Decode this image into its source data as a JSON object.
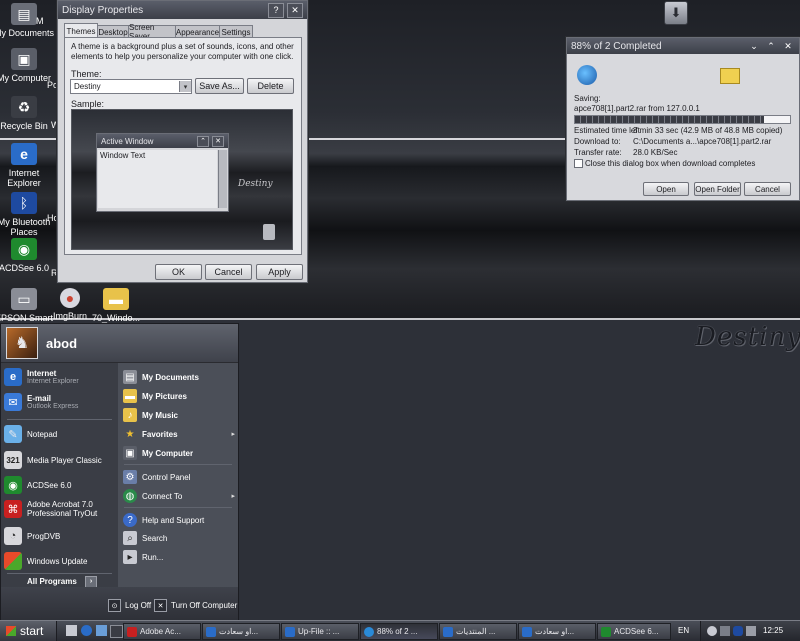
{
  "desktop": {
    "brand": "Destiny",
    "icons": [
      {
        "label": "My Documents"
      },
      {
        "label": "My Computer"
      },
      {
        "label": "Recycle Bin"
      },
      {
        "label": "Internet Explorer"
      },
      {
        "label": "My Bluetooth Places"
      },
      {
        "label": "ACDSee 6.0"
      },
      {
        "label": "EPSON Smart Panel"
      },
      {
        "label": "ImgBurn"
      },
      {
        "label": "70_Windo..."
      }
    ],
    "partial_labels": {
      "my_docs_m": "M",
      "po": "Po",
      "w": "W",
      "ho": "Ho",
      "r": "R"
    }
  },
  "display_props": {
    "title": "Display Properties",
    "tabs": [
      "Themes",
      "Desktop",
      "Screen Saver",
      "Appearance",
      "Settings"
    ],
    "description": "A theme is a background plus a set of sounds, icons, and other elements to help you personalize your computer with one click.",
    "theme_label": "Theme:",
    "theme_value": "Destiny",
    "save_as": "Save As...",
    "delete": "Delete",
    "sample_label": "Sample:",
    "active_window": "Active Window",
    "window_text": "Window Text",
    "preview_brand": "Destiny",
    "ok": "OK",
    "cancel": "Cancel",
    "apply": "Apply"
  },
  "download": {
    "title": "88% of 2 Completed",
    "saving_label": "Saving:",
    "saving_value": "apce708[1].part2.rar from 127.0.0.1",
    "progress": 0.88,
    "time_left_label": "Estimated time left",
    "time_left_value": "3 min 33 sec (42.9 MB of 48.8 MB copied)",
    "download_to_label": "Download to:",
    "download_to_value": "C:\\Documents a...\\apce708[1].part2.rar",
    "rate_label": "Transfer rate:",
    "rate_value": "28.0 KB/Sec",
    "close_checkbox": "Close this dialog box when download completes",
    "open": "Open",
    "open_folder": "Open Folder",
    "cancel": "Cancel"
  },
  "start_menu": {
    "user": "abod",
    "pinned": [
      {
        "name": "Internet",
        "sub": "Internet Explorer"
      },
      {
        "name": "E-mail",
        "sub": "Outlook Express"
      }
    ],
    "recent": [
      {
        "name": "Notepad"
      },
      {
        "name": "Media Player Classic"
      },
      {
        "name": "ACDSee 6.0"
      },
      {
        "name": "Adobe Acrobat 7.0",
        "sub": "Professional TryOut"
      },
      {
        "name": "ProgDVB"
      },
      {
        "name": "Windows Update"
      }
    ],
    "all_programs": "All Programs",
    "right": [
      {
        "name": "My Documents"
      },
      {
        "name": "My Pictures"
      },
      {
        "name": "My Music"
      },
      {
        "name": "Favorites"
      },
      {
        "name": "My Computer"
      },
      {
        "name": "Control Panel"
      },
      {
        "name": "Connect To"
      },
      {
        "name": "Help and Support"
      },
      {
        "name": "Search"
      },
      {
        "name": "Run..."
      }
    ],
    "log_off": "Log Off",
    "turn_off": "Turn Off Computer"
  },
  "taskbar": {
    "start": "start",
    "tasks": [
      "Adobe Ac...",
      "او سعادت...",
      "Up-File :: ...",
      "88% of 2 ...",
      "المنتديات ...",
      "او سعادت...",
      "ACDSee 6..."
    ],
    "lang": "EN",
    "clock": "12:25"
  },
  "colors": {
    "accent": "#5a5e6a",
    "progress": "#3a3c44"
  }
}
